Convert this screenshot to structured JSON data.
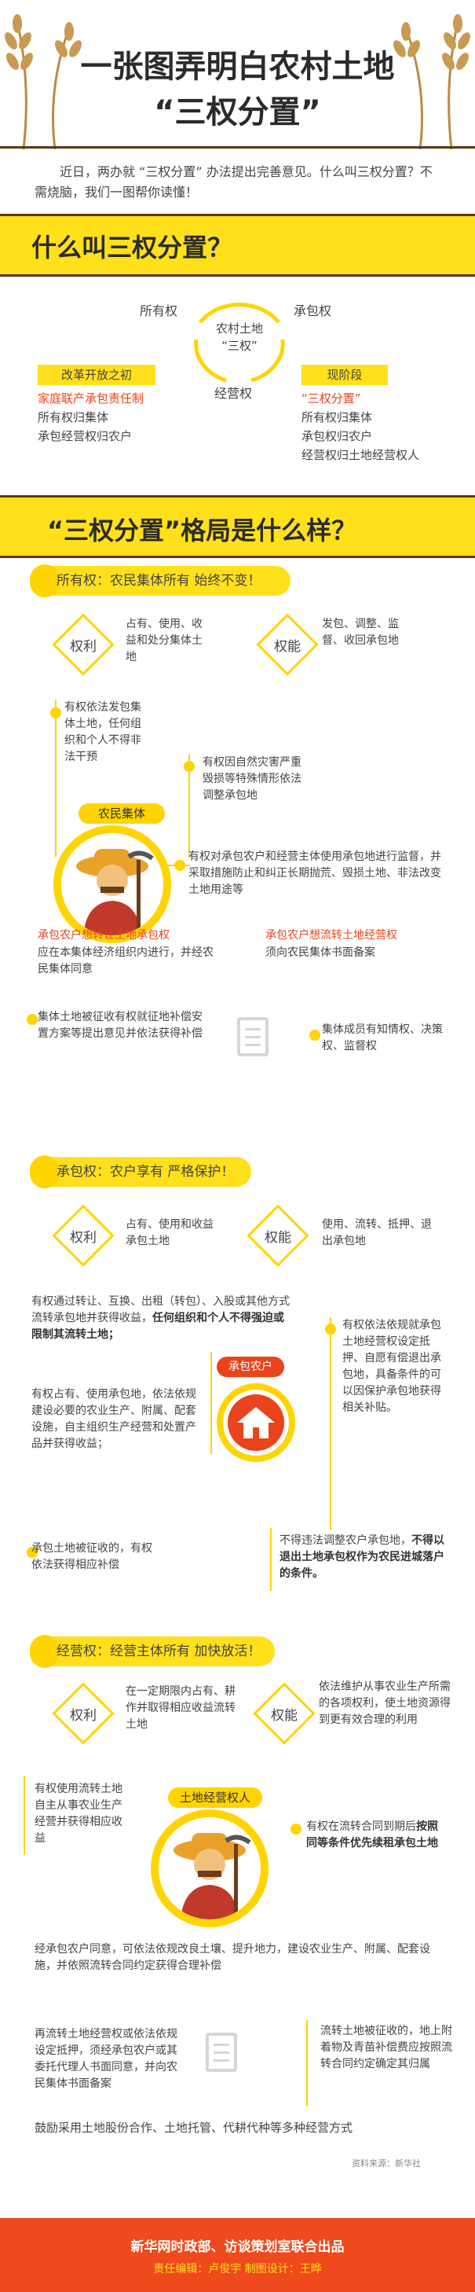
{
  "header": {
    "title_line1": "一张图弄明白农村土地",
    "title_line2": "“三权分置”"
  },
  "intro": "近日，两办就 “三权分置” 办法提出完善意见。什么叫三权分置？不需烧脑，我们一图帮你读懂！",
  "section1": {
    "title": "什么叫三权分置？",
    "center_line1": "农村土地",
    "center_line2": "“三权”",
    "left_label": "所有权",
    "right_label": "承包权",
    "bottom_label": "经营权",
    "reform_title": "改革开放之初",
    "reform_items": [
      "家庭联产承包责任制",
      "所有权归集体",
      "承包经营权归农户"
    ],
    "current_title": "现阶段",
    "current_items": [
      "“三权分置”",
      "所有权归集体",
      "承包权归农户",
      "经营权归土地经营权人"
    ]
  },
  "section2": {
    "title": "“三权分置”格局是什么样？"
  },
  "ownership": {
    "pill": "所有权：农民集体所有    始终不变！",
    "rights_label": "权利",
    "rights_text": "占有、使用、收益和处分集体土地",
    "powers_label": "权能",
    "powers_text": "发包、调整、监督、收回承包地",
    "left1": "有权依法发包集体土地，任何组织和个人不得非法干预",
    "right1": "有权因自然灾害严重毁损等特殊情形依法调整承包地",
    "avatar_label": "农民集体",
    "right2": "有权对承包农户和经营主体使用承包地进行监督，并采取措施防止和纠正长期抛荒、毁损土地、非法改变土地用途等",
    "col1_title": "承包农户想转让土地承包权",
    "col1_text": "应在本集体经济组织内进行，并经农民集体同意",
    "col2_title": "承包农户想流转土地经营权",
    "col2_text": "须向农民集体书面备案",
    "left3": "集体土地被征收有权就征地补偿安置方案等提出意见并依法获得补偿",
    "right3": "集体成员有知情权、决策权、监督权"
  },
  "contract": {
    "pill": "承包权：农户享有 严格保护！",
    "rights_label": "权利",
    "rights_text": "占有、使用和收益承包土地",
    "powers_label": "权能",
    "powers_text": "使用、流转、抵押、退出承包地",
    "left1_a": "有权通过转让、互换、出租（转包）、入股或其他方式流转承包地并获得收益，",
    "left1_b": "任何组织和个人不得强迫或限制其流转土地；",
    "left2": "有权占有、使用承包地，依法依规建设必要的农业生产、附属、配套设施，自主组织生产经营和处置产品并获得收益；",
    "avatar_label": "承包农户",
    "right1": "有权依法依规就承包土地经营权设定抵押、自愿有偿退出承包地，具备条件的可以因保护承包地获得相关补贴。",
    "left3": "承包土地被征收的，有权依法获得相应补偿",
    "right2_a": "不得违法调整农户承包地，",
    "right2_b": "不得以退出土地承包权作为农民进城落户的条件。"
  },
  "operation": {
    "pill": "经营权：经营主体所有 加快放活！",
    "rights_label": "权利",
    "rights_text": "在一定期限内占有、耕作并取得相应收益流转土地",
    "powers_label": "权能",
    "powers_text": "依法维护从事农业生产所需的各项权利，使土地资源得到更有效合理的利用",
    "left1": "有权使用流转土地自主从事农业生产经营并获得相应收益",
    "avatar_label": "土地经营权人",
    "right1_a": "有权在流转合同到期后",
    "right1_b": "按照同等条件优先续租承包土地",
    "full1": "经承包农户同意，可依法依规改良土壤、提升地力，建设农业生产、附属、配套设施，并依照流转合同约定获得合理补偿",
    "left2": "再流转土地经营权或依法依规设定抵押，须经承包农户或其委托代理人书面同意，并向农民集体书面备案",
    "right2": "流转土地被征收的，地上附着物及青苗补偿费应按照流转合同约定确定其归属",
    "closing": "鼓励采用土地股份合作、土地托管、代耕代种等多种经营方式"
  },
  "source": "资料来源：新华社",
  "footer": {
    "line1": "新华网时政部、访谈策划室联合出品",
    "line2": "责任编辑：卢俊宇    制图设计：王晔"
  },
  "colors": {
    "accent": "#ffe01b",
    "brown": "#5a3a12",
    "red": "#e9441c",
    "footer": "#ef4a1d"
  }
}
